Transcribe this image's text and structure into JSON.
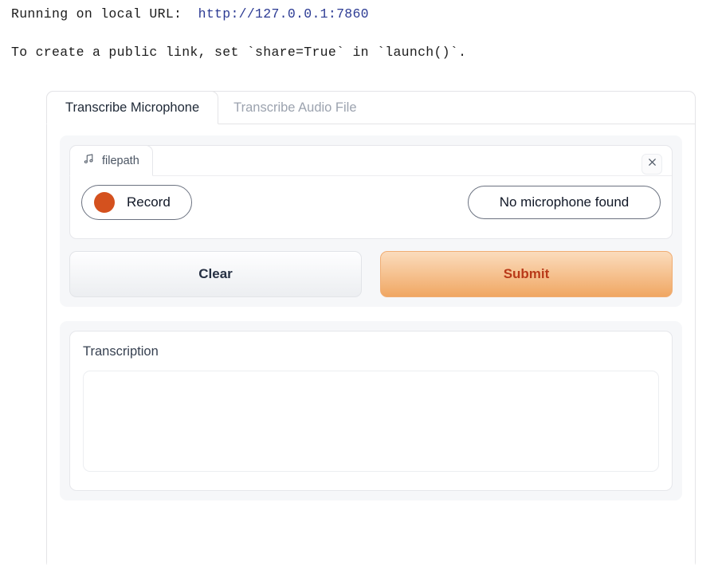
{
  "console": {
    "lines": [
      {
        "prefix": "Running on local URL:  ",
        "url": "http://127.0.0.1:7860"
      },
      {
        "text": "To create a public link, set `share=True` in `launch()`."
      }
    ],
    "url_color": "#2b3a93"
  },
  "tabs": [
    {
      "label": "Transcribe Microphone",
      "active": true
    },
    {
      "label": "Transcribe Audio File",
      "active": false
    }
  ],
  "audio": {
    "source_tab_label": "filepath",
    "source_tab_icon": "music-note-icon",
    "close_icon": "close-icon",
    "record_button_label": "Record",
    "record_dot_icon": "record-dot-icon",
    "record_dot_color": "#d4511e",
    "microphone_select_value": "No microphone found"
  },
  "actions": {
    "clear_label": "Clear",
    "submit_label": "Submit",
    "submit_text_color": "#b93a19"
  },
  "transcription": {
    "label": "Transcription",
    "value": "",
    "placeholder": ""
  }
}
